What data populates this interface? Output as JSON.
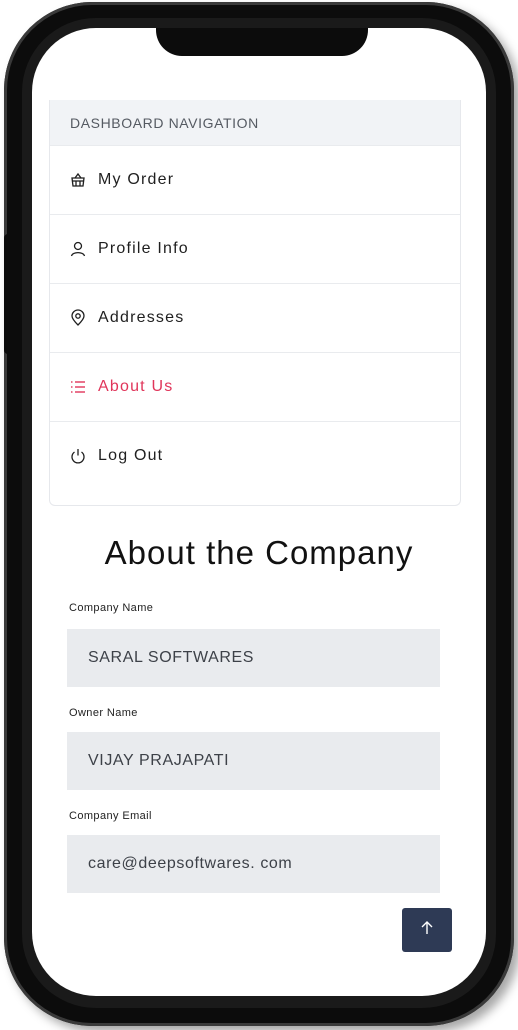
{
  "nav": {
    "header": "DASHBOARD NAVIGATION",
    "items": [
      {
        "label": "My Order",
        "icon": "basket-icon",
        "active": false
      },
      {
        "label": "Profile Info",
        "icon": "user-icon",
        "active": false
      },
      {
        "label": "Addresses",
        "icon": "location-pin-icon",
        "active": false
      },
      {
        "label": "About Us",
        "icon": "list-icon",
        "active": true
      },
      {
        "label": "Log Out",
        "icon": "power-icon",
        "active": false
      }
    ]
  },
  "about": {
    "title": "About the Company",
    "fields": [
      {
        "label": "Company Name",
        "value": "SARAL SOFTWARES"
      },
      {
        "label": "Owner Name",
        "value": "VIJAY PRAJAPATI"
      },
      {
        "label": "Company Email",
        "value": "care@deepsoftwares. com"
      }
    ]
  },
  "colors": {
    "accent": "#e0355a",
    "button": "#2e3a55",
    "field_bg": "#e9ebee"
  }
}
